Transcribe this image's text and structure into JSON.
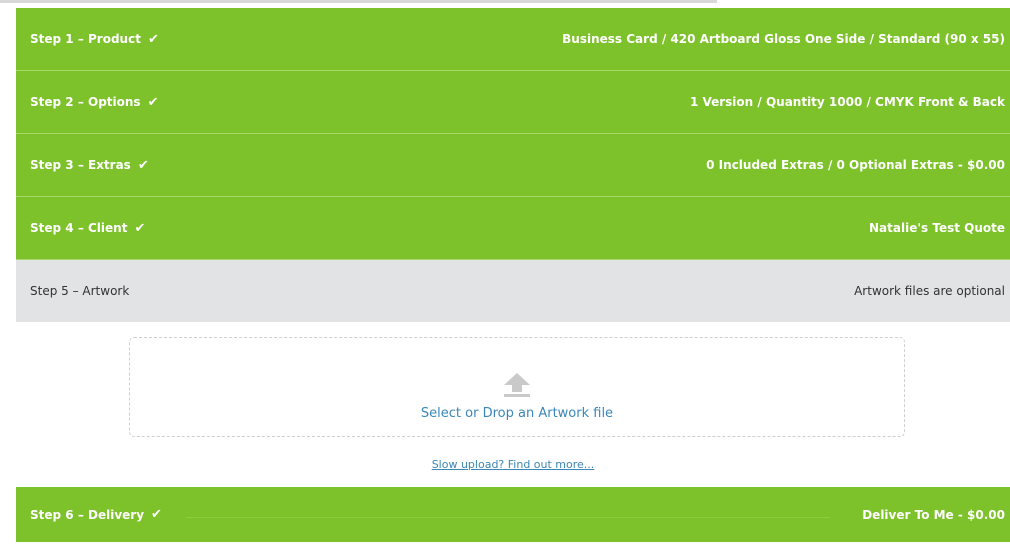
{
  "steps": [
    {
      "label": "Step 1 – Product",
      "check": "✔",
      "summary": "Business Card  /  420 Artboard Gloss One Side  /  Standard (90 x 55)"
    },
    {
      "label": "Step 2 – Options",
      "check": "✔",
      "summary": "1 Version  /  Quantity 1000  /  CMYK Front & Back"
    },
    {
      "label": "Step 3 – Extras",
      "check": "✔",
      "summary": "0 Included Extras  /  0 Optional Extras  - $0.00"
    },
    {
      "label": "Step 4 – Client",
      "check": "✔",
      "summary": "Natalie's Test Quote"
    },
    {
      "label": "Step 5 – Artwork",
      "summary": "Artwork files are optional"
    },
    {
      "label": "Step 6 – Delivery",
      "check": "✔",
      "summary": "Deliver To Me  - $0.00"
    }
  ],
  "artwork": {
    "upload_icon": "upload-arrow-icon",
    "drop_label": "Select or Drop an Artwork file",
    "slow_upload_link": "Slow upload? Find out more..."
  },
  "colors": {
    "completed_step": "#7dc22a",
    "active_step": "#e1e3e4",
    "link": "#3a87b8"
  }
}
